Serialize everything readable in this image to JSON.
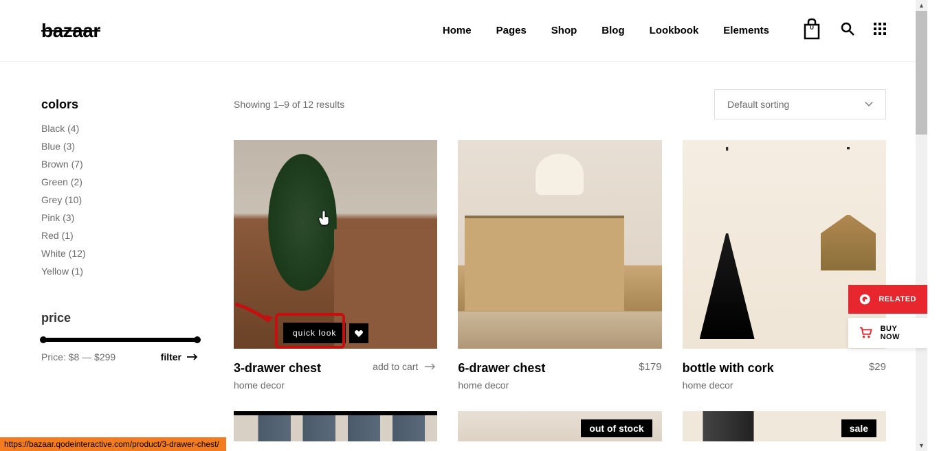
{
  "logo": "bazaar",
  "nav": [
    "Home",
    "Pages",
    "Shop",
    "Blog",
    "Lookbook",
    "Elements"
  ],
  "cart_count": "0",
  "sidebar": {
    "colors_heading": "colors",
    "colors": [
      {
        "name": "Black",
        "count": "(4)"
      },
      {
        "name": "Blue",
        "count": "(3)"
      },
      {
        "name": "Brown",
        "count": "(7)"
      },
      {
        "name": "Green",
        "count": "(2)"
      },
      {
        "name": "Grey",
        "count": "(10)"
      },
      {
        "name": "Pink",
        "count": "(3)"
      },
      {
        "name": "Red",
        "count": "(1)"
      },
      {
        "name": "White",
        "count": "(12)"
      },
      {
        "name": "Yellow",
        "count": "(1)"
      }
    ],
    "price_heading": "price",
    "price_label": "Price: $8 — $299",
    "filter_label": "filter"
  },
  "results_text": "Showing 1–9 of 12 results",
  "sort_label": "Default sorting",
  "quick_look_label": "quick look",
  "add_cart_label": "add to cart",
  "products": [
    {
      "title": "3-drawer chest",
      "cat": "home decor",
      "price": ""
    },
    {
      "title": "6-drawer chest",
      "cat": "home decor",
      "price": "$179"
    },
    {
      "title": "bottle with cork",
      "cat": "home decor",
      "price": "$29"
    }
  ],
  "badges": {
    "out_of_stock": "out of stock",
    "sale": "sale"
  },
  "float": {
    "related": "RELATED",
    "buy": "BUY NOW"
  },
  "status_url": "https://bazaar.qodeinteractive.com/product/3-drawer-chest/"
}
